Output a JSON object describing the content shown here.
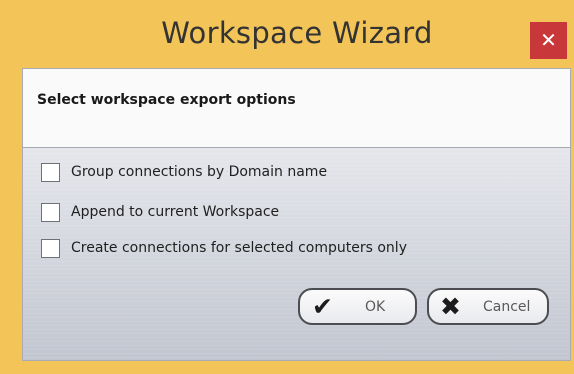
{
  "window": {
    "title": "Workspace Wizard",
    "close_glyph": "✕"
  },
  "header": {
    "text": "Select workspace export options"
  },
  "options": [
    {
      "label": "Group connections by Domain name",
      "checked": false
    },
    {
      "label": "Append to current Workspace",
      "checked": false
    },
    {
      "label": "Create connections for selected computers only",
      "checked": false
    }
  ],
  "buttons": {
    "ok_label": "OK",
    "ok_icon": "checkmark-icon",
    "cancel_label": "Cancel",
    "cancel_icon": "x-mark-icon"
  },
  "colors": {
    "frame": "#f3c458",
    "close_button": "#c8373a"
  }
}
